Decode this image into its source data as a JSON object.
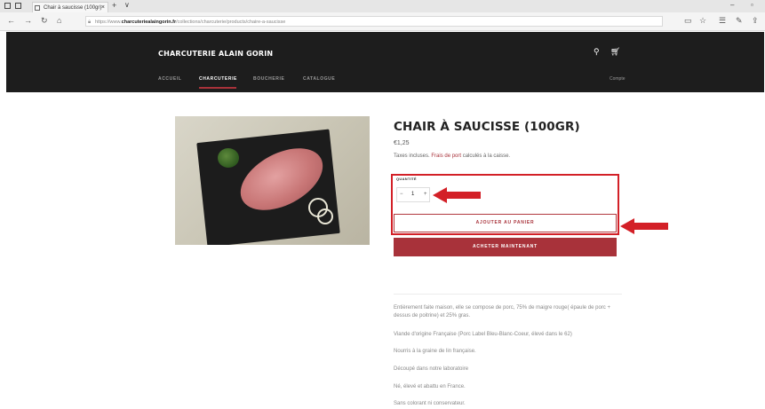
{
  "browser": {
    "tab_title": "Chair à saucisse (100gr)",
    "tab_close": "×",
    "new_tab": "+",
    "tab_menu": "∨",
    "url_prefix": "https://www.",
    "url_domain": "charcuteriealaingorin.fr",
    "url_path": "/collections/charcuterie/products/chaire-a-saucisse"
  },
  "header": {
    "logo": "CHARCUTERIE ALAIN GORIN",
    "nav": [
      {
        "label": "ACCUEIL"
      },
      {
        "label": "CHARCUTERIE"
      },
      {
        "label": "BOUCHERIE"
      },
      {
        "label": "CATALOGUE"
      }
    ],
    "account": "Compte"
  },
  "product": {
    "title": "CHAIR À SAUCISSE (100GR)",
    "price": "€1,25",
    "taxes_prefix": "Taxes incluses. ",
    "taxes_link": "Frais de port",
    "taxes_suffix": " calculés à la caisse.",
    "quantity_label": "QUANTITÉ",
    "quantity_minus": "−",
    "quantity_value": "1",
    "quantity_plus": "+",
    "add_to_cart": "AJOUTER AU PANIER",
    "buy_now": "ACHETER MAINTENANT",
    "description": [
      "Entièrement faite maison, elle se compose de porc, 75% de maigre rouge( épaule de porc + dessus de poitrine) et 25% gras.",
      "Viande d'origine Française (Porc Label Bleu-Blanc-Coeur, élevé dans le 62)",
      "Nourris à la graine de lin française.",
      "Découpé dans notre laboratoire",
      "Né, élevé et abattu en France.",
      "Sans colorant ni conservateur."
    ]
  },
  "colors": {
    "accent": "#a8323a",
    "header_bg": "#1d1d1d",
    "annotation_red": "#d32027"
  }
}
